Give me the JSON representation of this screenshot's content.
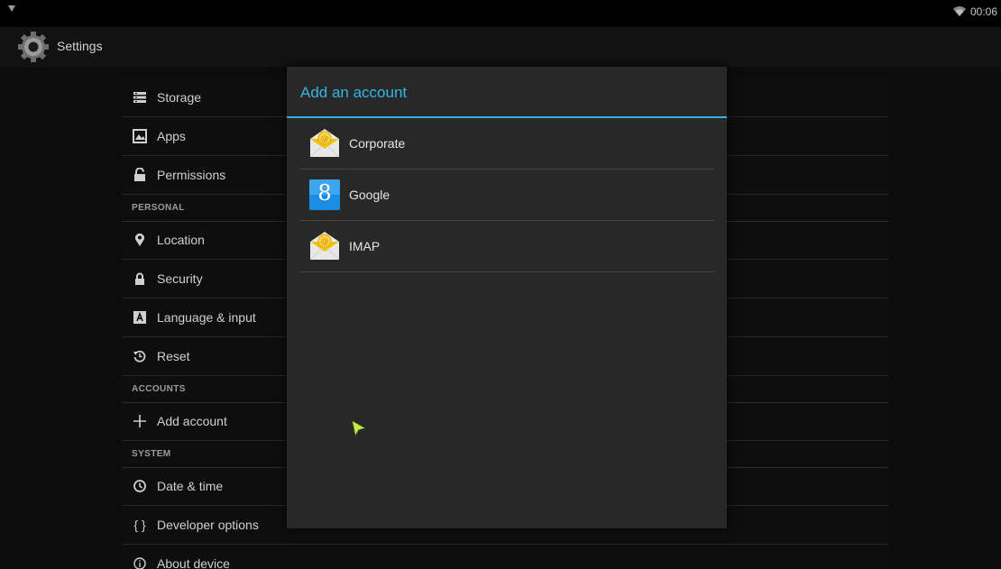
{
  "status_bar": {
    "left_icon": "signal-icon",
    "wifi_icon": "wifi-icon",
    "time": "00:06"
  },
  "action_bar": {
    "icon": "settings-gear-icon",
    "title": "Settings"
  },
  "settings": {
    "storage": {
      "label": "Storage",
      "icon": "storage-icon"
    },
    "apps": {
      "label": "Apps",
      "icon": "apps-icon"
    },
    "permissions": {
      "label": "Permissions",
      "icon": "lock-open-icon"
    },
    "personal_header": "PERSONAL",
    "location": {
      "label": "Location",
      "icon": "location-pin-icon"
    },
    "security": {
      "label": "Security",
      "icon": "lock-icon"
    },
    "language": {
      "label": "Language & input",
      "icon": "keyboard-a-icon"
    },
    "reset": {
      "label": "Reset",
      "icon": "reset-icon"
    },
    "accounts_header": "ACCOUNTS",
    "add_account": {
      "label": "Add account",
      "icon": "plus-icon"
    },
    "system_header": "SYSTEM",
    "date_time": {
      "label": "Date & time",
      "icon": "clock-icon"
    },
    "developer": {
      "label": "Developer options",
      "icon": "braces-icon",
      "glyph": "{ }"
    },
    "about": {
      "label": "About device",
      "icon": "info-icon"
    }
  },
  "dialog": {
    "title": "Add an account",
    "accent_color": "#33b5e5",
    "accounts": [
      {
        "label": "Corporate",
        "icon": "email-envelope-icon"
      },
      {
        "label": "Google",
        "icon": "google-icon",
        "glyph": "8"
      },
      {
        "label": "IMAP",
        "icon": "email-envelope-icon"
      }
    ]
  }
}
